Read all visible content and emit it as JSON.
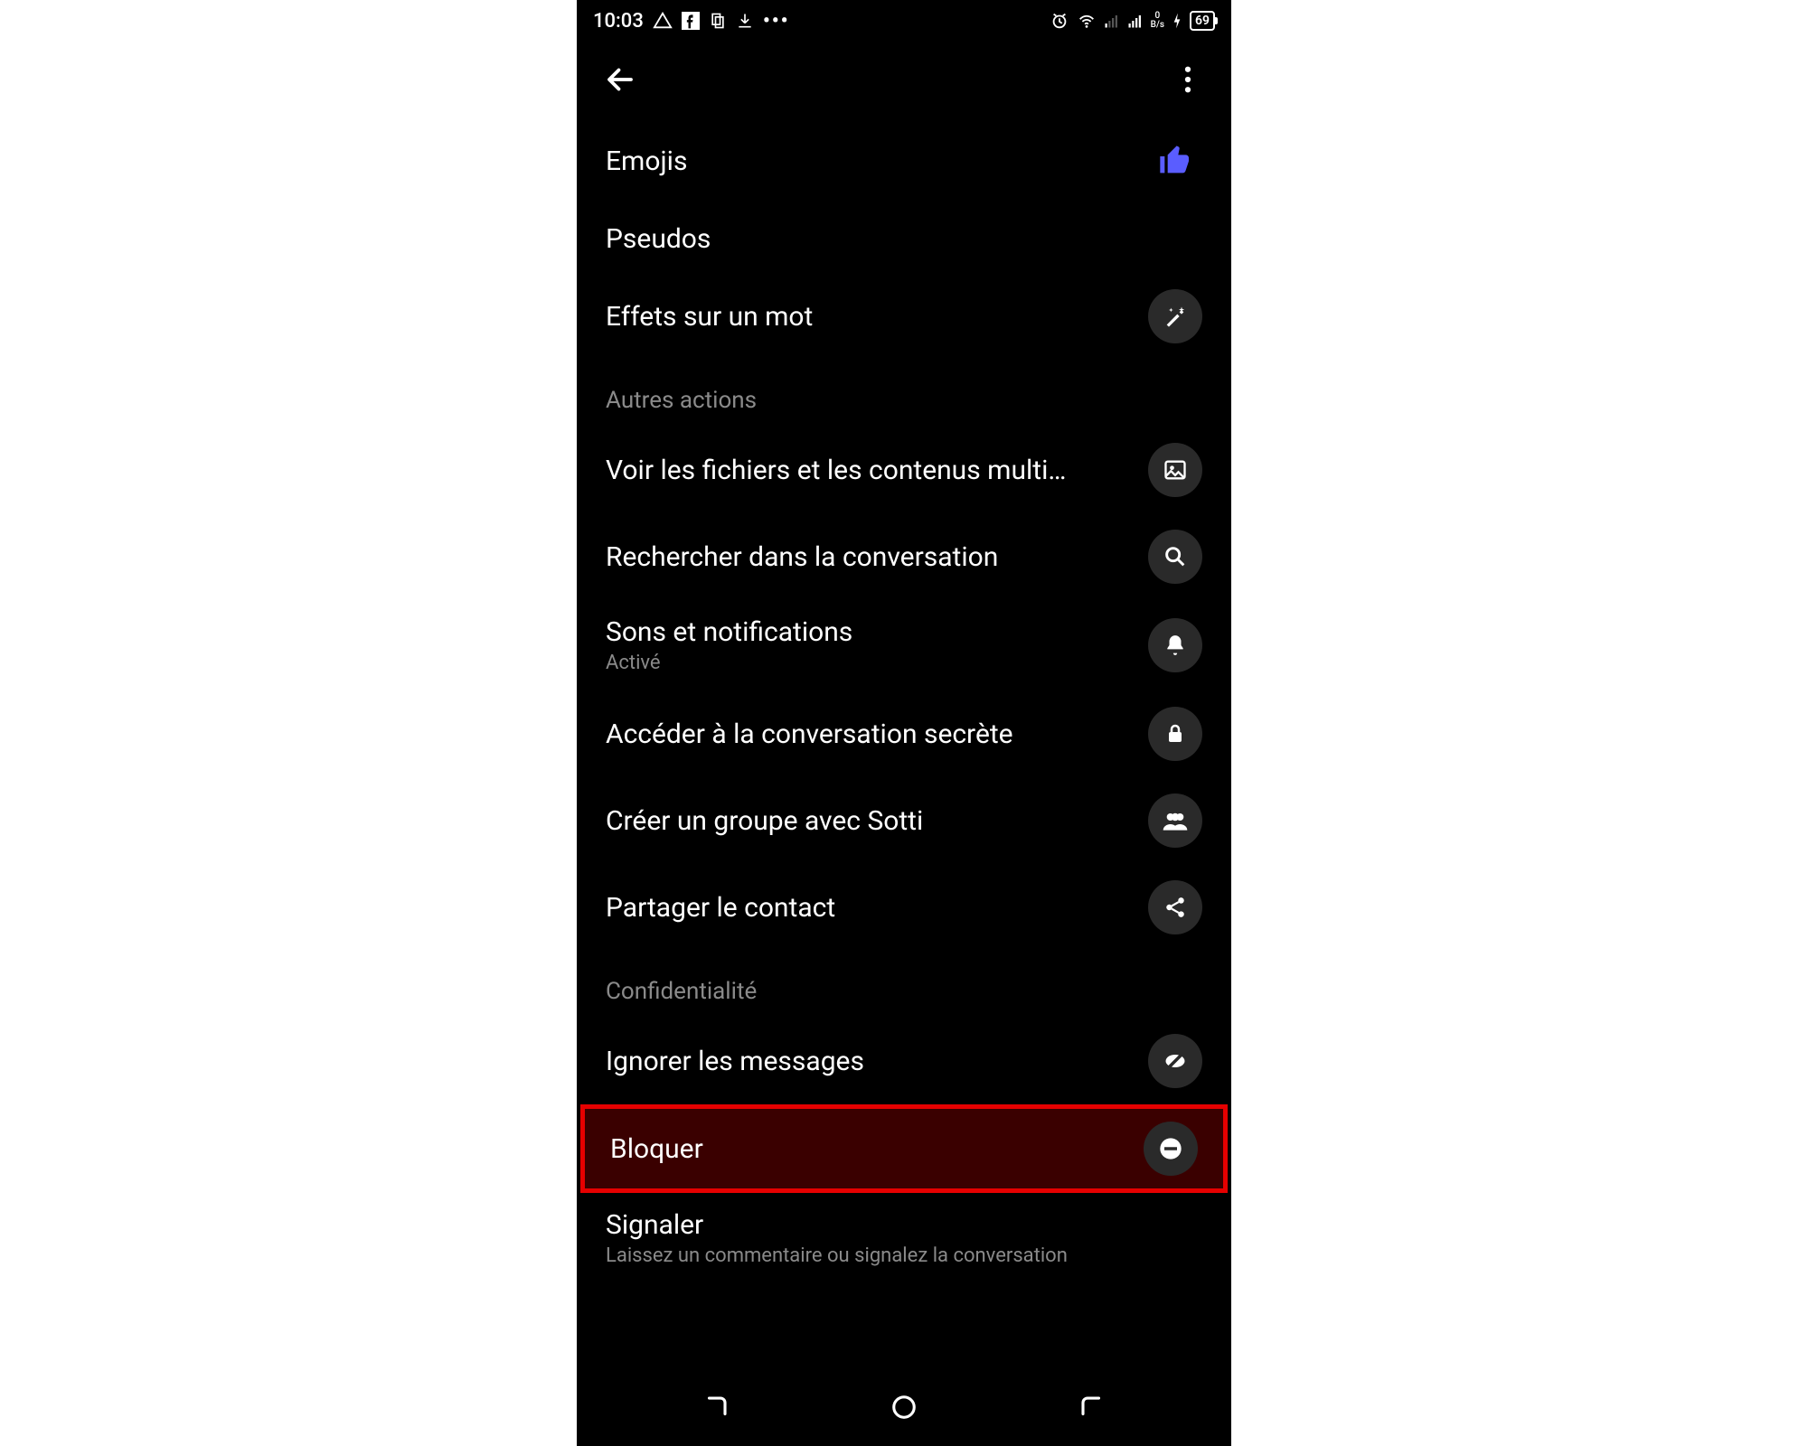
{
  "status_bar": {
    "time": "10:03",
    "data_rate": "0",
    "data_unit": "B/s",
    "battery": "69"
  },
  "menu": {
    "emojis": "Emojis",
    "pseudos": "Pseudos",
    "effets": "Effets sur un mot"
  },
  "sections": {
    "actions_header": "Autres actions",
    "voir_fichiers": "Voir les fichiers et les contenus multi…",
    "rechercher": "Rechercher dans la conversation",
    "sons_title": "Sons et notifications",
    "sons_sub": "Activé",
    "secrete": "Accéder à la conversation secrète",
    "groupe": "Créer un groupe avec Sotti",
    "partager": "Partager le contact",
    "privacy_header": "Confidentialité",
    "ignorer": "Ignorer les messages",
    "bloquer": "Bloquer",
    "signaler_title": "Signaler",
    "signaler_sub": "Laissez un commentaire ou signalez la conversation"
  }
}
